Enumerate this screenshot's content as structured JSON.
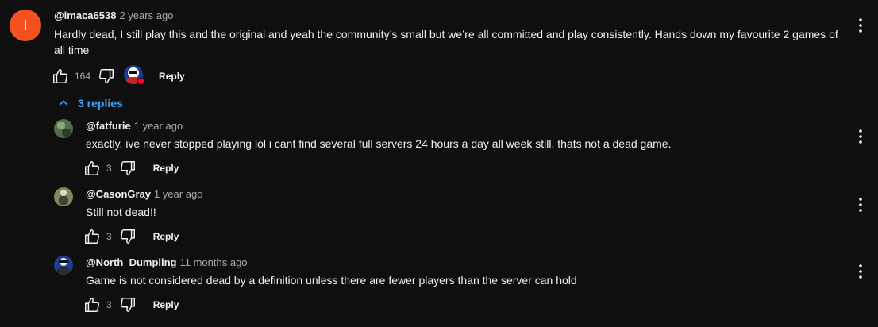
{
  "top_comment": {
    "avatar_letter": "I",
    "handle": "@imaca6538",
    "time": "2 years ago",
    "text": "Hardly dead, I still play this and the original and yeah the community’s small but we’re all committed and play consistently. Hands down my favourite 2 games of all time",
    "likes": "164",
    "reply_label": "Reply"
  },
  "replies_toggle": {
    "label": "3 replies"
  },
  "replies": [
    {
      "handle": "@fatfurie",
      "time": "1 year ago",
      "text": "exactly. ive never stopped playing lol i cant find several full servers 24 hours a day all week still. thats not a  dead game.",
      "likes": "3",
      "reply_label": "Reply"
    },
    {
      "handle": "@CasonGray",
      "time": "1 year ago",
      "text": "Still not dead!!",
      "likes": "3",
      "reply_label": "Reply"
    },
    {
      "handle": "@North_Dumpling",
      "time": "11 months ago",
      "text": "Game is not considered dead by a definition unless there are fewer players than the server can hold",
      "likes": "3",
      "reply_label": "Reply"
    }
  ],
  "colors": {
    "background": "#0f0f0f",
    "accent": "#3ea6ff",
    "avatar": "#f4511e",
    "secondary_text": "#aaaaaa"
  },
  "icons": [
    "thumb-up-icon",
    "thumb-down-icon",
    "more-vert-icon",
    "chevron-up-icon",
    "creator-heart-icon"
  ]
}
